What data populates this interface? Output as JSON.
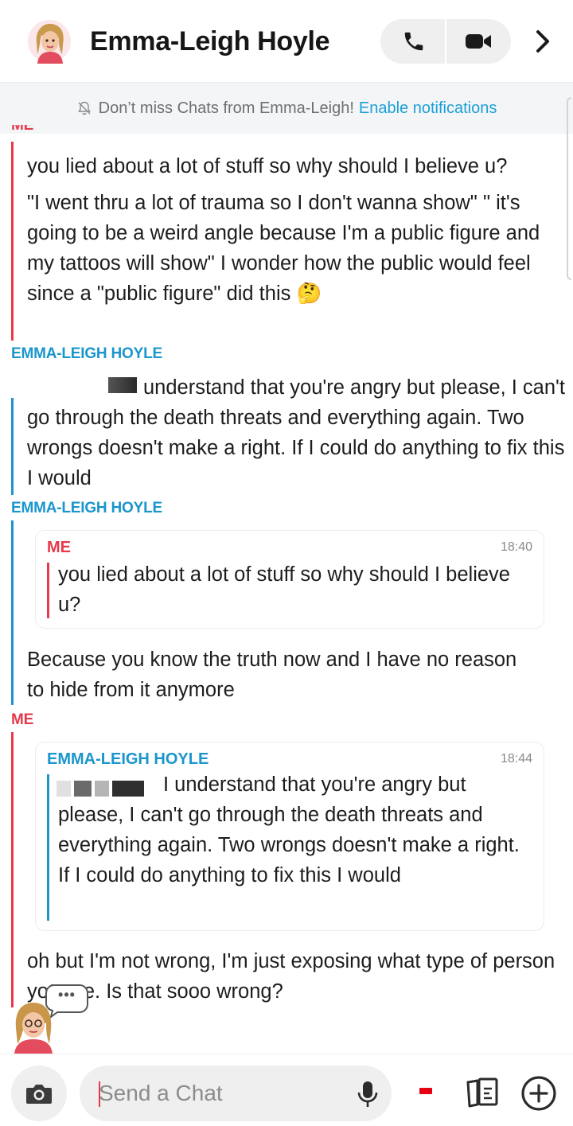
{
  "header": {
    "contact_name": "Emma-Leigh Hoyle"
  },
  "notification": {
    "text": "Don’t miss Chats from Emma-Leigh!",
    "link": "Enable notifications"
  },
  "messages": [
    {
      "sender": "ME",
      "lines": [
        "you lied about a lot of stuff so why should I believe u?",
        "\"I went thru a lot of trauma so I don't wanna show\" \" it's going to be a weird angle because I'm a public figure and my tattoos will show\" I wonder how the public would feel since a \"public figure\" did this"
      ],
      "emoji": "🤔"
    },
    {
      "sender": "EMMA-LEIGH HOYLE",
      "text": "understand that you're angry but please, I can't go through the death threats and everything again. Two wrongs doesn't make a right. If I could do anything to fix this I would"
    },
    {
      "sender": "EMMA-LEIGH HOYLE",
      "quote": {
        "sender": "ME",
        "time": "18:40",
        "text": "you lied about a lot of stuff so why should I believe u?"
      },
      "text": "Because you know the truth now and I have no reason to hide from it anymore"
    },
    {
      "sender": "ME",
      "quote": {
        "sender": "EMMA-LEIGH HOYLE",
        "time": "18:44",
        "text": "I understand that you're angry but please, I can't go through the death threats and everything again. Two wrongs doesn't make a right. If I could do anything to fix this I would"
      },
      "text": "oh but I'm not wrong, I'm just exposing what type of person you are. Is that sooo wrong?"
    }
  ],
  "typing_indicator": "•••",
  "composer": {
    "placeholder": "Send a Chat"
  },
  "icons": {
    "phone": "phone-icon",
    "video": "video-camera-icon",
    "chevron": "chevron-right-icon",
    "bell": "bell-off-icon",
    "camera": "camera-icon",
    "mic": "microphone-icon",
    "cards": "cards-icon",
    "plus": "plus-circle-icon"
  },
  "colors": {
    "me": "#e6394a",
    "her": "#1a96cc",
    "link": "#1aa0d8"
  }
}
